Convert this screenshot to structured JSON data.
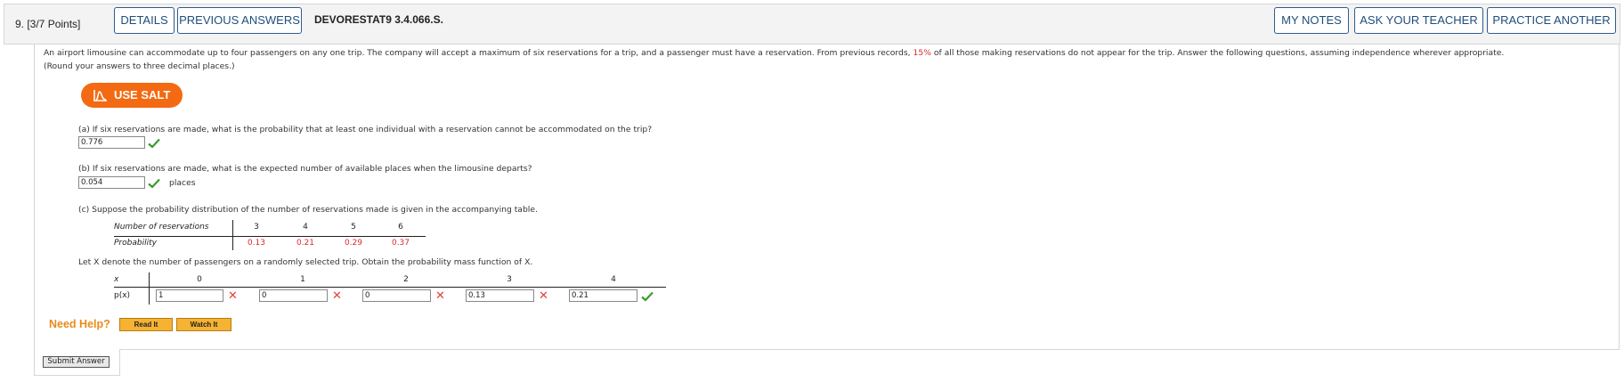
{
  "header": {
    "question_number": "9.  [3/7 Points]",
    "details_label": "DETAILS",
    "previous_answers_label": "PREVIOUS ANSWERS",
    "problem_code": "DEVORESTAT9 3.4.066.S.",
    "my_notes_label": "MY NOTES",
    "ask_teacher_label": "ASK YOUR TEACHER",
    "practice_another_label": "PRACTICE ANOTHER"
  },
  "problem": {
    "intro_before": "An airport limousine can accommodate up to four passengers on any one trip. The company will accept a maximum of six reservations for a trip, and a passenger must have a reservation. From previous records, ",
    "intro_highlight": "15%",
    "intro_after": " of all those making reservations do not appear for the trip. Answer the following questions, assuming independence wherever appropriate.",
    "rounding_note": "(Round your answers to three decimal places.)",
    "use_salt_label": "USE SALT"
  },
  "part_a": {
    "question": "(a) If six reservations are made, what is the probability that at least one individual with a reservation cannot be accommodated on the trip?",
    "answer": "0.776"
  },
  "part_b": {
    "question": "(b) If six reservations are made, what is the expected number of available places when the limousine departs?",
    "answer": "0.054",
    "unit": "places"
  },
  "part_c": {
    "question": "(c) Suppose the probability distribution of the number of reservations made is given in the accompanying table.",
    "reservations_table": {
      "row1_label": "Number of reservations",
      "row2_label": "Probability",
      "values": [
        "3",
        "4",
        "5",
        "6"
      ],
      "probabilities": [
        "0.13",
        "0.21",
        "0.29",
        "0.37"
      ]
    },
    "pmf_instruction": "Let X denote the number of passengers on a randomly selected trip. Obtain the probability mass function of X.",
    "pmf_table": {
      "row1_label": "x",
      "row2_label": "p(x)",
      "x_values": [
        "0",
        "1",
        "2",
        "3",
        "4"
      ],
      "answers": [
        "1",
        "0",
        "0",
        "0.13",
        "0.21"
      ],
      "status": [
        "incorrect",
        "incorrect",
        "incorrect",
        "incorrect",
        "correct"
      ]
    }
  },
  "help": {
    "label": "Need Help?",
    "read_it_label": "Read It",
    "watch_it_label": "Watch It"
  },
  "submit_label": "Submit Answer",
  "colors": {
    "salt_orange": "#f36a12",
    "correct_green": "#3a9a2e",
    "incorrect_red": "#e0413b",
    "highlight_red": "#d62c2c",
    "button_blue": "#2f5d8f",
    "help_orange": "#e98b1c"
  }
}
